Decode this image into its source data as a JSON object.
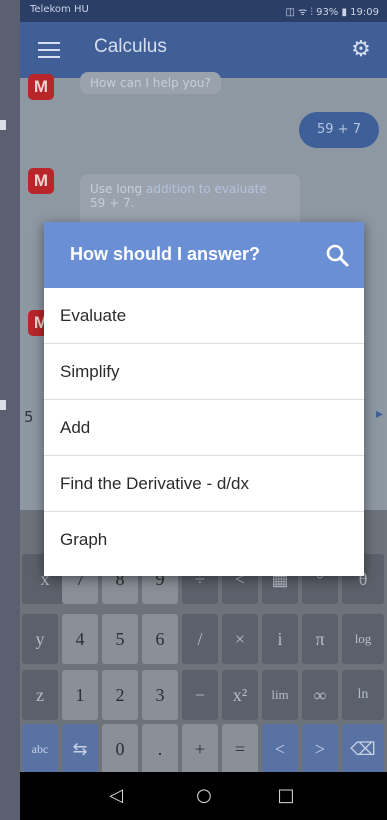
{
  "status_bar": {
    "carrier": "Telekom HU",
    "right": "◫ ᯤ ⫶ 93% ▮ 19:09"
  },
  "app_bar": {
    "title": "Calculus",
    "menu_icon": "hamburger-icon",
    "settings_icon": "gear-icon"
  },
  "chat": {
    "top_bubble": "How can I help you?",
    "badge_letter": "M",
    "user_message": "59 + 7",
    "bot_message_prefix": "Use long",
    "bot_message_link": "addition to evaluate",
    "bot_message_suffix": "59 + 7.",
    "partial_left": "5",
    "partial_right": "▸"
  },
  "dialog": {
    "title": "How should I answer?",
    "search_icon": "search-icon",
    "options": [
      "Evaluate",
      "Simplify",
      "Add",
      "Find the Derivative - d/dx",
      "Graph"
    ]
  },
  "keyboard": {
    "row1": [
      "x",
      "7",
      "8",
      "9",
      "÷",
      "<",
      "▦",
      "°",
      "θ"
    ],
    "row2": [
      "y",
      "4",
      "5",
      "6",
      "/",
      "×",
      "i",
      "π",
      "log"
    ],
    "row3": [
      "z",
      "1",
      "2",
      "3",
      "−",
      "x²",
      "lim",
      "∞",
      "ln"
    ],
    "row4": [
      "abc",
      "⇆",
      "0",
      ".",
      "+",
      "=",
      "<",
      ">",
      "⌫"
    ]
  },
  "navbar": {
    "back": "◁",
    "home": "○",
    "recents": "□"
  }
}
